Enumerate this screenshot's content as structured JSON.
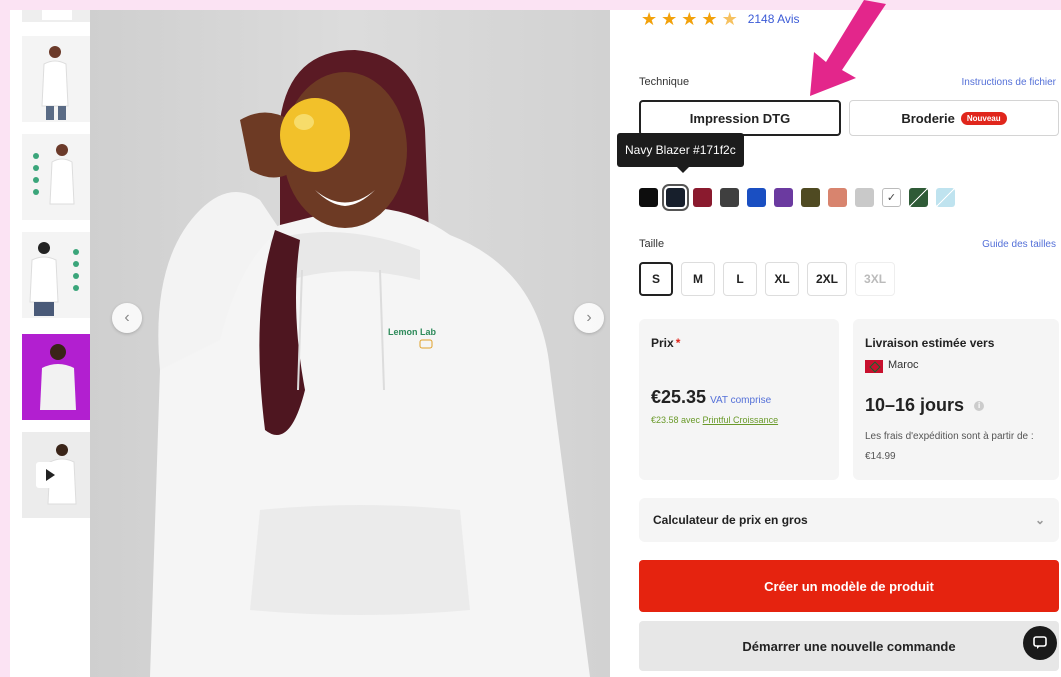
{
  "rating": {
    "stars": 4.5,
    "reviews_text": "2148 Avis"
  },
  "technique": {
    "label": "Technique",
    "file_link": "Instructions de fichier",
    "options": [
      {
        "label": "Impression DTG",
        "selected": true
      },
      {
        "label": "Broderie",
        "badge": "Nouveau",
        "selected": false
      }
    ]
  },
  "color": {
    "tooltip": "Navy Blazer #171f2c",
    "swatches": [
      {
        "name": "black",
        "hex": "#0d0d0d"
      },
      {
        "name": "navy-blazer",
        "hex": "#171f2c",
        "selected": true
      },
      {
        "name": "maroon",
        "hex": "#8a1a2e"
      },
      {
        "name": "dark-heather",
        "hex": "#3f3f3f"
      },
      {
        "name": "royal",
        "hex": "#1a4fc2"
      },
      {
        "name": "purple",
        "hex": "#6b3aa0"
      },
      {
        "name": "military-green",
        "hex": "#4f4a22"
      },
      {
        "name": "salmon",
        "hex": "#d8846e"
      },
      {
        "name": "light-grey",
        "hex": "#c9c9c9"
      },
      {
        "name": "white",
        "hex": "#ffffff"
      },
      {
        "name": "forest-stripe",
        "hex": "#2f5b37"
      },
      {
        "name": "light-blue-stripe",
        "hex": "#bfe3ef"
      }
    ]
  },
  "size": {
    "label": "Taille",
    "guide_link": "Guide des tailles",
    "options": [
      {
        "label": "S",
        "selected": true
      },
      {
        "label": "M"
      },
      {
        "label": "L"
      },
      {
        "label": "XL"
      },
      {
        "label": "2XL"
      },
      {
        "label": "3XL",
        "disabled": true
      }
    ]
  },
  "price": {
    "title": "Prix",
    "required_mark": "*",
    "amount": "€25.35",
    "vat": "VAT comprise",
    "alt_price_prefix": "€23.58 avec ",
    "alt_price_link": "Printful Croissance"
  },
  "shipping": {
    "title": "Livraison estimée vers",
    "country": "Maroc",
    "days": "10–16 jours",
    "note": "Les frais d'expédition sont à partir de : €14.99"
  },
  "bulk": {
    "label": "Calculateur de prix en gros"
  },
  "buttons": {
    "primary": "Créer un modèle de produit",
    "secondary": "Démarrer une nouvelle commande"
  },
  "hero": {
    "logo_text": "Lemon Lab"
  },
  "colors": {
    "accent": "#e5230f",
    "link": "#5470d8",
    "star": "#f2a10a",
    "pink_arrow": "#e3268b"
  }
}
